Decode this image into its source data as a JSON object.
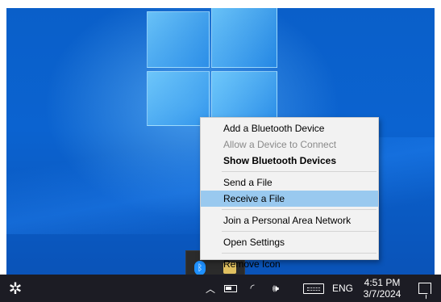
{
  "context_menu": {
    "items": [
      {
        "label": "Add a Bluetooth Device"
      },
      {
        "label": "Allow a Device to Connect"
      },
      {
        "label": "Show Bluetooth Devices"
      },
      {
        "label": "Send a File"
      },
      {
        "label": "Receive a File"
      },
      {
        "label": "Join a Personal Area Network"
      },
      {
        "label": "Open Settings"
      },
      {
        "label": "Remove Icon"
      }
    ]
  },
  "tray_flyout": {
    "bluetooth_glyph": "ᛒ"
  },
  "taskbar": {
    "settings_glyph": "✲",
    "chevron_glyph": "︿",
    "wifi_glyph": "◜",
    "volume_glyph": "🕪",
    "language": "ENG",
    "time": "4:51 PM",
    "date": "3/7/2024"
  },
  "colors": {
    "desktop_blue": "#0b63d0",
    "taskbar": "#1c1c24",
    "menu_bg": "#f2f2f2",
    "menu_highlight": "#99c9ef"
  }
}
